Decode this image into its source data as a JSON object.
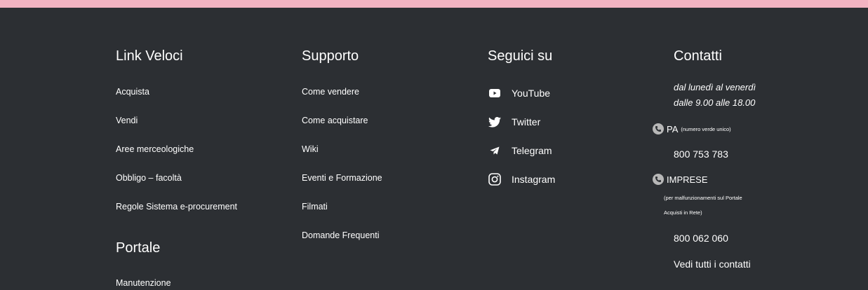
{
  "col1": {
    "title": "Link Veloci",
    "links": [
      "Acquista",
      "Vendi",
      "Aree merceologiche",
      "Obbligo – facoltà",
      "Regole Sistema e-procurement"
    ],
    "portale_title": "Portale",
    "portale_links": [
      "Manutenzione"
    ]
  },
  "col2": {
    "title": "Supporto",
    "links": [
      "Come vendere",
      "Come acquistare",
      "Wiki",
      "Eventi e Formazione",
      "Filmati",
      "Domande Frequenti"
    ]
  },
  "col3": {
    "title": "Seguici su",
    "social": [
      {
        "label": "YouTube",
        "icon": "youtube-icon"
      },
      {
        "label": "Twitter",
        "icon": "twitter-icon"
      },
      {
        "label": "Telegram",
        "icon": "telegram-icon"
      },
      {
        "label": "Instagram",
        "icon": "instagram-icon"
      }
    ]
  },
  "col4": {
    "title": "Contatti",
    "hours_line1": "dal lunedì al venerdì",
    "hours_line2": "dalle 9.00 alle 18.00",
    "pa_label": "PA",
    "pa_note": "(numero verde unico)",
    "pa_phone": "800 753 783",
    "imprese_label": "IMPRESE",
    "imprese_note_line1": "(per malfunzionamenti sul Portale",
    "imprese_note_line2": "Acquisti in Rete)",
    "imprese_phone": "800 062 060",
    "all_contacts": "Vedi tutti i contatti"
  },
  "colors": {
    "background": "#2c2f33",
    "top_bar": "#f2b3c2",
    "text": "#ffffff",
    "phone_icon": "#b7b7b7"
  }
}
